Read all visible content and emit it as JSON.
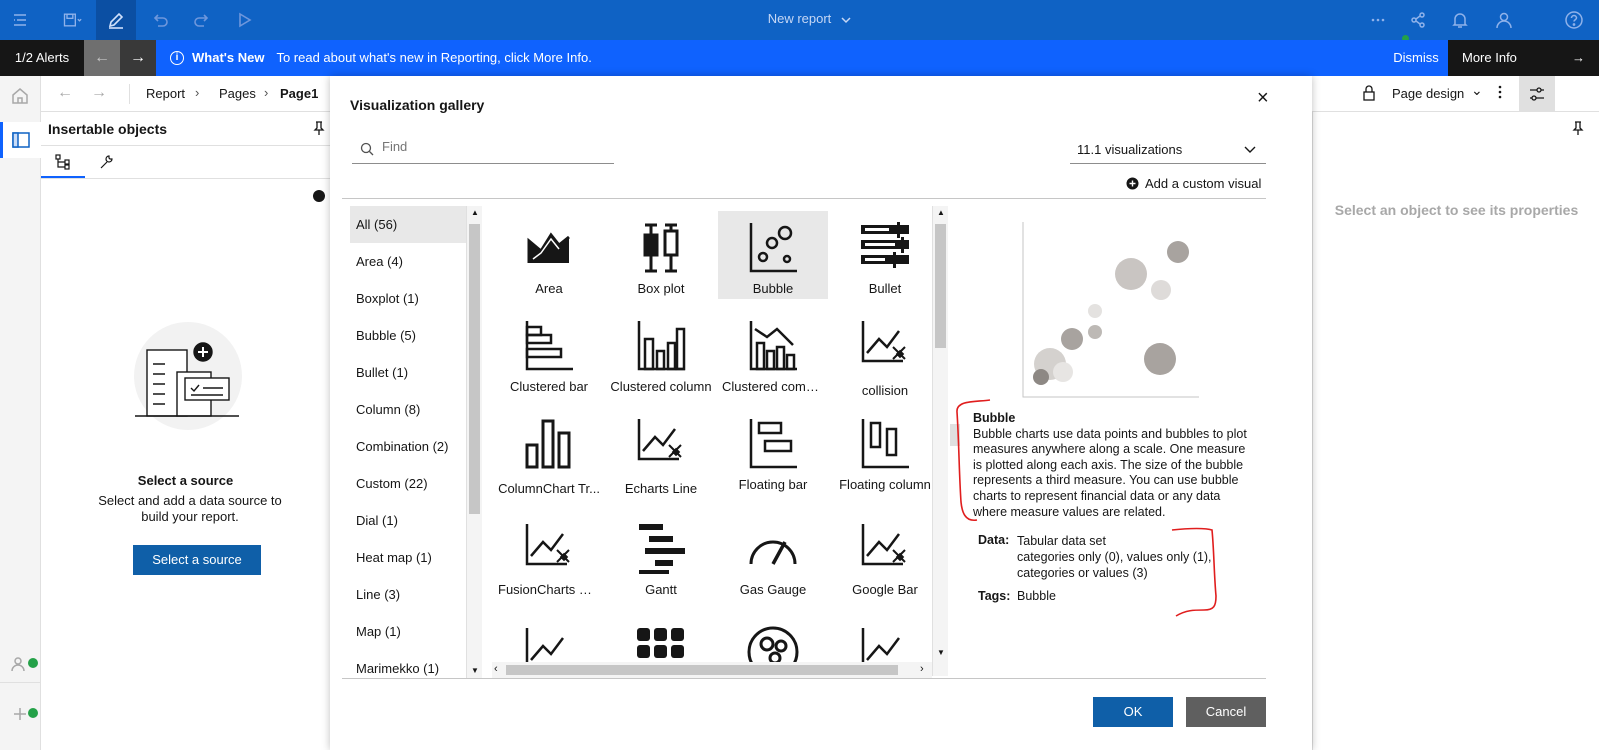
{
  "topbar": {
    "title": "New report"
  },
  "alerts": {
    "count": "1/2 Alerts",
    "headline": "What's New",
    "message": "To read about what's new in Reporting, click More Info.",
    "dismiss": "Dismiss",
    "more_info": "More Info"
  },
  "breadcrumb": {
    "items": [
      "Report",
      "Pages"
    ],
    "current": "Page1"
  },
  "insertable": {
    "title": "Insertable objects",
    "empty_title": "Select a source",
    "empty_text": "Select and add a data source to build your report.",
    "button": "Select a source"
  },
  "rightbar": {
    "mode": "Page design"
  },
  "properties": {
    "hint": "Select an object to see its properties"
  },
  "gallery": {
    "title": "Visualization gallery",
    "search_placeholder": "Find",
    "version": "11.1 visualizations",
    "add_custom": "Add a custom visual",
    "categories": [
      "All (56)",
      "Area (4)",
      "Boxplot (1)",
      "Bubble (5)",
      "Bullet (1)",
      "Column (8)",
      "Combination (2)",
      "Custom (22)",
      "Dial (1)",
      "Heat map (1)",
      "Line (3)",
      "Map (1)",
      "Marimekko (1)"
    ],
    "tiles": [
      {
        "label": "Area",
        "icon": "area-icon"
      },
      {
        "label": "Box plot",
        "icon": "box-plot-icon"
      },
      {
        "label": "Bubble",
        "icon": "bubble-icon"
      },
      {
        "label": "Bullet",
        "icon": "bullet-icon"
      },
      {
        "label": "Clustered bar",
        "icon": "clustered-bar-icon"
      },
      {
        "label": "Clustered column",
        "icon": "clustered-column-icon"
      },
      {
        "label": "Clustered combi...",
        "icon": "clustered-combination-icon"
      },
      {
        "label": "collision",
        "icon": "custom-visual-icon"
      },
      {
        "label": "ColumnChart Tr...",
        "icon": "column-chart-icon"
      },
      {
        "label": "Echarts Line",
        "icon": "custom-visual-icon"
      },
      {
        "label": "Floating bar",
        "icon": "floating-bar-icon"
      },
      {
        "label": "Floating column",
        "icon": "floating-column-icon"
      },
      {
        "label": "FusionCharts Pa...",
        "icon": "custom-visual-icon"
      },
      {
        "label": "Gantt",
        "icon": "gantt-icon"
      },
      {
        "label": "Gas Gauge",
        "icon": "gauge-icon"
      },
      {
        "label": "Google Bar",
        "icon": "custom-visual-icon"
      }
    ],
    "detail": {
      "name": "Bubble",
      "description": "Bubble charts use data points and bubbles to plot measures anywhere along a scale. One measure is plotted along each axis. The size of the bubble represents a third measure. You can use bubble charts to represent financial data or any data where measure values are related.",
      "data_label": "Data:",
      "data_lines": [
        "Tabular data set",
        "categories only (0),  values only (1),",
        "categories or values (3)"
      ],
      "tags_label": "Tags:",
      "tags": "Bubble"
    },
    "ok": "OK",
    "cancel": "Cancel"
  },
  "colors": {
    "brand": "#0f62c4",
    "alert": "#0f62fe",
    "primary_button": "#0f5fa8",
    "secondary_button": "#5f5f5f",
    "annotation": "#e01e1e"
  }
}
